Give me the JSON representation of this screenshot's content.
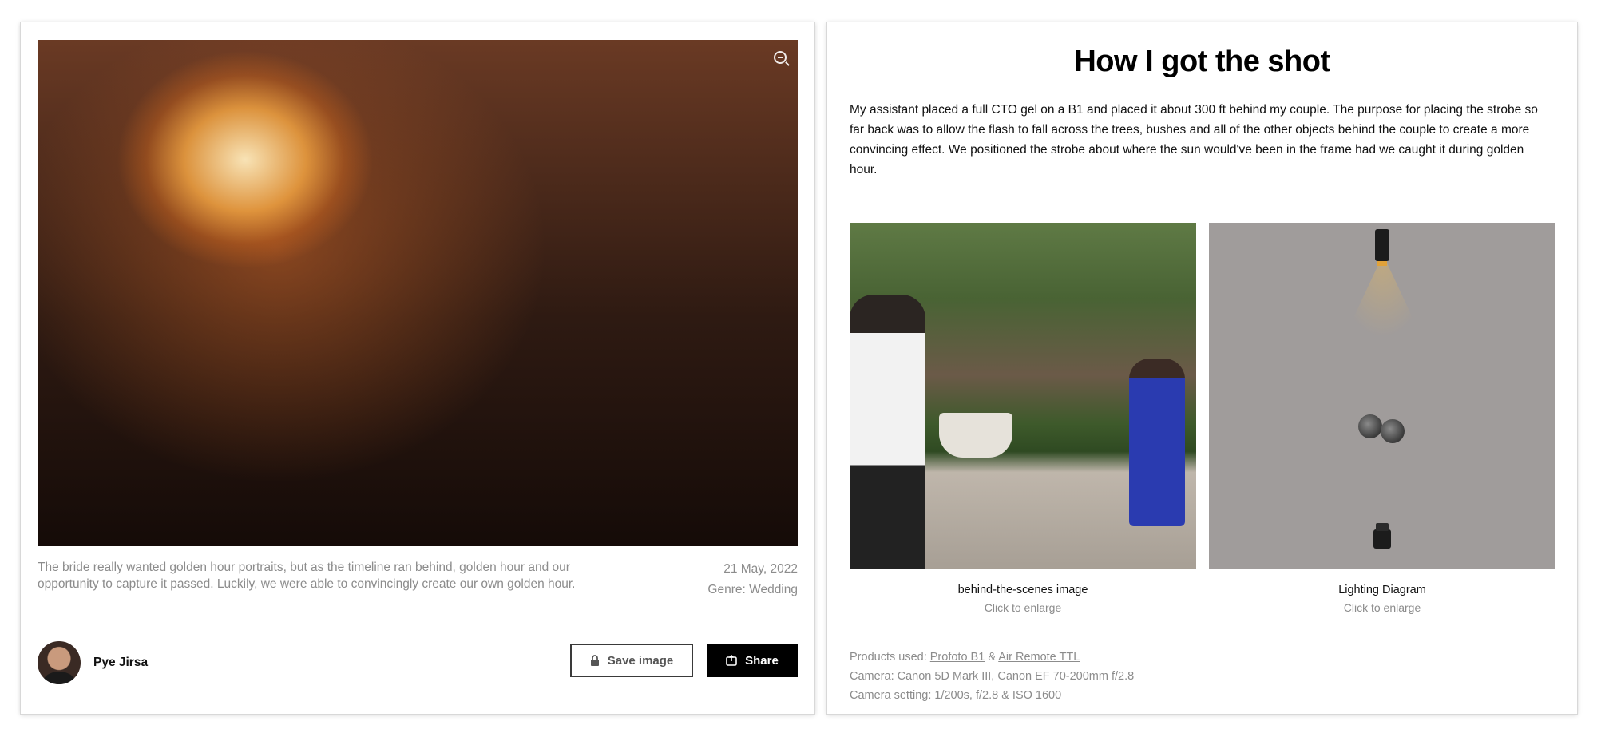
{
  "photo": {
    "caption": "The bride really wanted golden hour portraits, but as the timeline ran behind, golden hour and our opportunity to capture it passed. Luckily, we were able to convincingly create our own golden hour.",
    "date": "21 May, 2022",
    "genre": "Genre: Wedding",
    "zoom_icon": "zoom-icon"
  },
  "author": {
    "name": "Pye Jirsa"
  },
  "actions": {
    "save_label": "Save image",
    "share_label": "Share",
    "save_icon": "lock-icon",
    "share_icon": "share-icon"
  },
  "shot": {
    "title": "How I got the shot",
    "description": "My assistant placed a full CTO gel on a B1 and placed it about 300 ft behind my couple. The purpose for placing the strobe so far back was to allow the flash to fall across the trees, bushes and all of the other objects behind the couple to create a more convincing effect. We positioned the strobe about where the sun would've been in the frame had we caught it during golden hour.",
    "images": [
      {
        "label": "behind-the-scenes image",
        "sub": "Click to enlarge"
      },
      {
        "label": "Lighting Diagram",
        "sub": "Click to enlarge"
      }
    ]
  },
  "gear": {
    "products_prefix": "Products used:",
    "product_1": "Profoto B1",
    "joiner": "&",
    "product_2": "Air Remote TTL",
    "camera": "Camera: Canon 5D Mark III, Canon EF 70-200mm f/2.8",
    "settings": "Camera setting: 1/200s, f/2.8 & ISO 1600"
  }
}
